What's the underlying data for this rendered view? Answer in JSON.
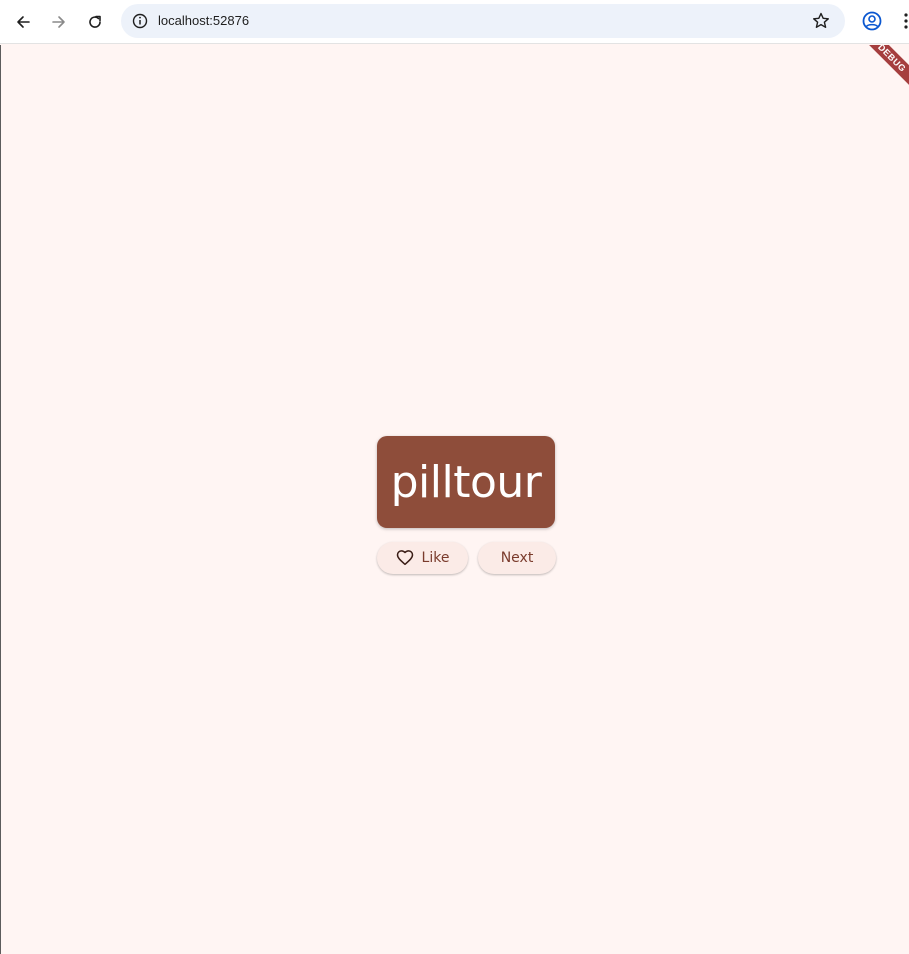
{
  "browser": {
    "url": "localhost:52876"
  },
  "app": {
    "debug_banner": "DEBUG",
    "word": "pilltour",
    "like_label": "Like",
    "next_label": "Next"
  },
  "colors": {
    "background": "#fff5f3",
    "card": "#8e4d3a",
    "button_bg": "#fbebe7",
    "button_text": "#7a3b2c",
    "banner": "#a53e3e"
  },
  "icons": {
    "back": "arrow-back-icon",
    "forward": "arrow-forward-icon",
    "reload": "reload-icon",
    "site_info": "info-icon",
    "bookmark": "star-icon",
    "profile": "profile-icon",
    "menu": "kebab-menu-icon",
    "like": "heart-outline-icon"
  }
}
